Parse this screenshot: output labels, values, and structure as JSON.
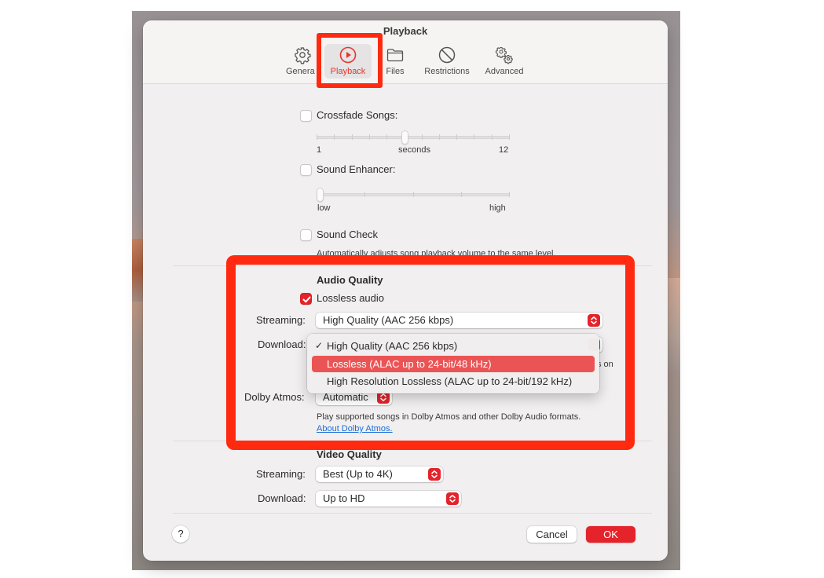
{
  "window": {
    "title": "Playback"
  },
  "tabs": [
    {
      "label": "General",
      "display_label": "Genera",
      "icon": "gear-icon",
      "active": false
    },
    {
      "label": "Playback",
      "icon": "play-circle-icon",
      "active": true
    },
    {
      "label": "Files",
      "icon": "folder-icon",
      "active": false
    },
    {
      "label": "Restrictions",
      "icon": "prohibited-icon",
      "active": false
    },
    {
      "label": "Advanced",
      "icon": "gears-icon",
      "active": false
    }
  ],
  "playback": {
    "crossfade": {
      "label": "Crossfade Songs:",
      "checked": false,
      "slider": {
        "min_label": "1",
        "unit_label": "seconds",
        "max_label": "12",
        "min": 1,
        "max": 12,
        "value": 6
      }
    },
    "sound_enhancer": {
      "label": "Sound Enhancer:",
      "checked": false,
      "slider": {
        "min_label": "low",
        "max_label": "high",
        "value_fraction": 0
      }
    },
    "sound_check": {
      "label": "Sound Check",
      "checked": false,
      "description": "Automatically adjusts song playback volume to the same level."
    }
  },
  "audio_quality": {
    "heading": "Audio Quality",
    "lossless": {
      "label": "Lossless audio",
      "checked": true
    },
    "streaming": {
      "label": "Streaming:",
      "value": "High Quality (AAC 256 kbps)"
    },
    "download": {
      "label": "Download:",
      "value": "High Quality (AAC 256 kbps)",
      "hidden_note_fragment": "s on",
      "menu_options": [
        {
          "label": "High Quality (AAC 256 kbps)",
          "checked": true,
          "highlighted": false
        },
        {
          "label": "Lossless (ALAC up to 24-bit/48 kHz)",
          "checked": false,
          "highlighted": true
        },
        {
          "label": "High Resolution Lossless (ALAC up to 24-bit/192 kHz)",
          "checked": false,
          "highlighted": false
        }
      ]
    },
    "dolby_atmos": {
      "label": "Dolby Atmos:",
      "value": "Automatic",
      "description": "Play supported songs in Dolby Atmos and other Dolby Audio formats.",
      "link": "About Dolby Atmos."
    }
  },
  "video_quality": {
    "heading": "Video Quality",
    "streaming": {
      "label": "Streaming:",
      "value": "Best (Up to 4K)"
    },
    "download": {
      "label": "Download:",
      "value": "Up to HD"
    }
  },
  "footer": {
    "help_label": "?",
    "cancel_label": "Cancel",
    "ok_label": "OK"
  },
  "colors": {
    "accent": "#e5232b",
    "menu_highlight": "#eb5455",
    "annotation": "#ff2a10",
    "link": "#1a6fd6"
  }
}
